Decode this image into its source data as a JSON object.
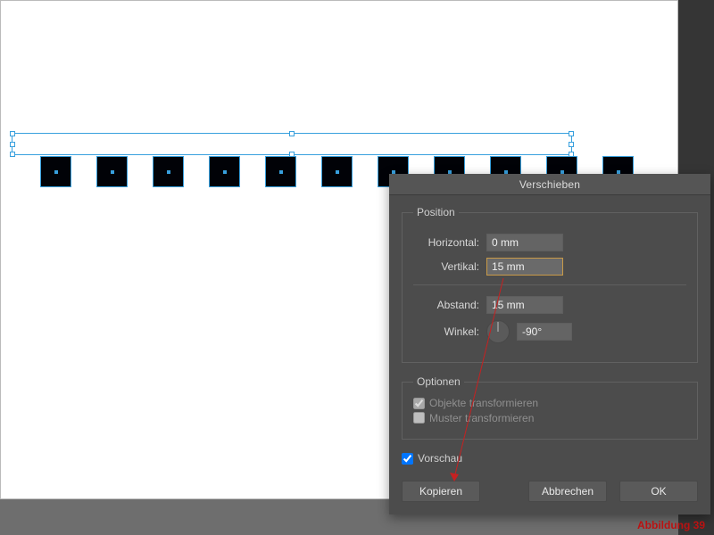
{
  "dialog": {
    "title": "Verschieben",
    "groups": {
      "position": {
        "legend": "Position",
        "horizontal_label": "Horizontal:",
        "horizontal_value": "0 mm",
        "vertikal_label": "Vertikal:",
        "vertikal_value": "15 mm",
        "abstand_label": "Abstand:",
        "abstand_value": "15 mm",
        "winkel_label": "Winkel:",
        "winkel_value": "-90°"
      },
      "optionen": {
        "legend": "Optionen",
        "objekte_label": "Objekte transformieren",
        "objekte_checked": true,
        "muster_label": "Muster transformieren",
        "muster_checked": false
      }
    },
    "vorschau_label": "Vorschau",
    "vorschau_checked": true,
    "buttons": {
      "kopieren": "Kopieren",
      "abbrechen": "Abbrechen",
      "ok": "OK"
    }
  },
  "caption": "Abbildung  39",
  "canvas": {
    "square_count": 11
  }
}
